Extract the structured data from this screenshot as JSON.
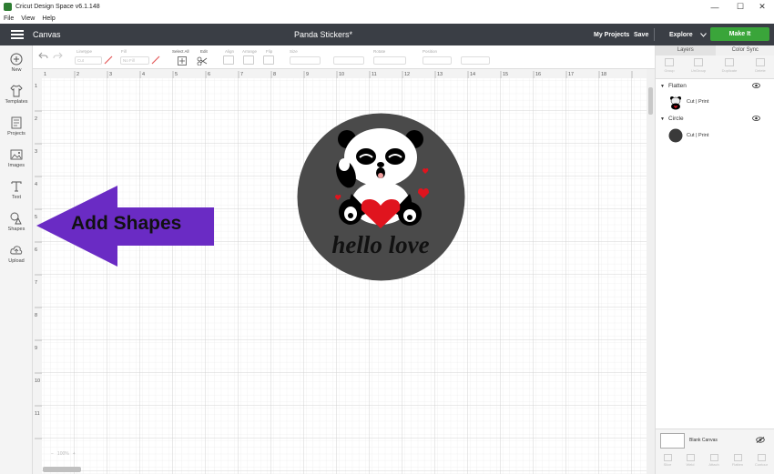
{
  "window": {
    "title": "Cricut Design Space  v6.1.148",
    "minimize": "—",
    "maximize": "☐",
    "close": "✕"
  },
  "menu": [
    "File",
    "View",
    "Help"
  ],
  "header": {
    "screen_name": "Canvas",
    "project_title": "Panda Stickers*",
    "my_projects": "My Projects",
    "save": "Save",
    "explore": "Explore",
    "make_it": "Make It",
    "make_it_color": "#3aa53a"
  },
  "sidebar": {
    "items": [
      {
        "label": "New",
        "icon": "plus-circle-icon"
      },
      {
        "label": "Templates",
        "icon": "shirt-icon"
      },
      {
        "label": "Projects",
        "icon": "projects-icon"
      },
      {
        "label": "Images",
        "icon": "image-icon"
      },
      {
        "label": "Text",
        "icon": "text-icon"
      },
      {
        "label": "Shapes",
        "icon": "shapes-icon"
      },
      {
        "label": "Upload",
        "icon": "upload-cloud-icon"
      }
    ]
  },
  "toolbar": {
    "linetype_label": "Linetype",
    "linetype_value": "Cut",
    "fill_label": "Fill",
    "fill_value": "No Fill",
    "select_all": "Select All",
    "edit": "Edit",
    "align": "Align",
    "arrange": "Arrange",
    "flip": "Flip",
    "size": "Size",
    "rotate": "Rotate",
    "position": "Position"
  },
  "ruler": {
    "top_ticks": [
      "1",
      "2",
      "3",
      "4",
      "5",
      "6",
      "7",
      "8",
      "9",
      "10",
      "11",
      "12",
      "13",
      "14",
      "15",
      "16",
      "17",
      "18"
    ],
    "left_ticks": [
      "1",
      "2",
      "3",
      "4",
      "5",
      "6",
      "7",
      "8",
      "9",
      "10",
      "11"
    ]
  },
  "zoom": {
    "value": "100%",
    "minus": "−",
    "plus": "+"
  },
  "sticker": {
    "text": "hello love",
    "circle_color": "#4a4a4a"
  },
  "callout": {
    "text": "Add Shapes",
    "color": "#6a2bc4"
  },
  "layers_panel": {
    "tabs": [
      "Layers",
      "Color Sync"
    ],
    "actions": [
      "Group",
      "UnGroup",
      "Duplicate",
      "Delete"
    ],
    "groups": [
      {
        "name": "Flatten",
        "layer_label": "Cut | Print"
      },
      {
        "name": "Circle",
        "layer_label": "Cut | Print"
      }
    ],
    "blank_canvas": "Blank Canvas",
    "bottom_actions": [
      "Slice",
      "Weld",
      "Attach",
      "Flatten",
      "Contour"
    ]
  }
}
